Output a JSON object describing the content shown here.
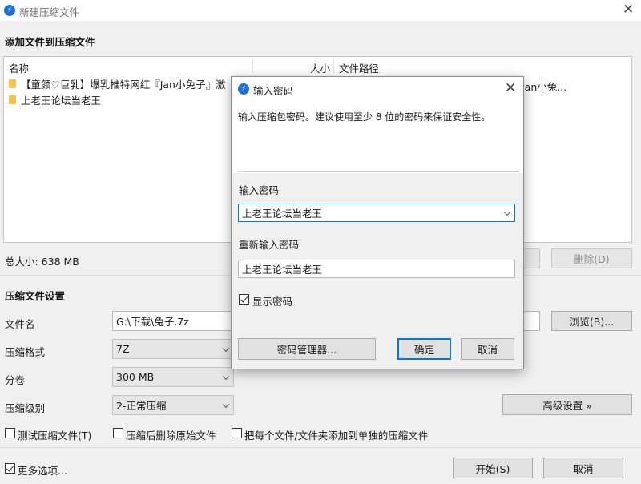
{
  "window": {
    "title": "新建压缩文件",
    "app_icon": "bandizip-icon"
  },
  "add_files": {
    "section_title": "添加文件到压缩文件",
    "columns": {
      "name": "名称",
      "size": "大小",
      "path": "文件路径"
    },
    "rows": [
      {
        "name": "【童颜♡巨乳】爆乳推特网红『Jan小兔子』激",
        "size": "",
        "path": "Jan小兔..."
      },
      {
        "name": "上老王论坛当老王",
        "size": "",
        "path": ""
      }
    ],
    "total_size": "总大小: 638 MB",
    "delete_label": "删除(D)"
  },
  "settings": {
    "section_title": "压缩文件设置",
    "filename_label": "文件名",
    "filename_value": "G:\\下载\\兔子.7z",
    "browse_label": "浏览(B)...",
    "format_label": "压缩格式",
    "format_value": "7Z",
    "split_label": "分卷",
    "split_value": "300 MB",
    "level_label": "压缩级别",
    "level_value": "2-正常压缩",
    "advanced_label": "高级设置 »",
    "test_label": "测试压缩文件(T)",
    "delete_after_label": "压缩后删除原始文件",
    "separate_label": "把每个文件/文件夹添加到单独的压缩文件",
    "more_options_label": "更多选项...",
    "start_label": "开始(S)",
    "cancel_label": "取消"
  },
  "password_dialog": {
    "title": "输入密码",
    "description": "输入压缩包密码。建议使用至少 8 位的密码来保证安全性。",
    "password_label": "输入密码",
    "password_value": "上老王论坛当老王",
    "confirm_label": "重新输入密码",
    "confirm_value": "上老王论坛当老王",
    "show_password_label": "显示密码",
    "manager_label": "密码管理器...",
    "ok_label": "确定",
    "cancel_label": "取消"
  }
}
